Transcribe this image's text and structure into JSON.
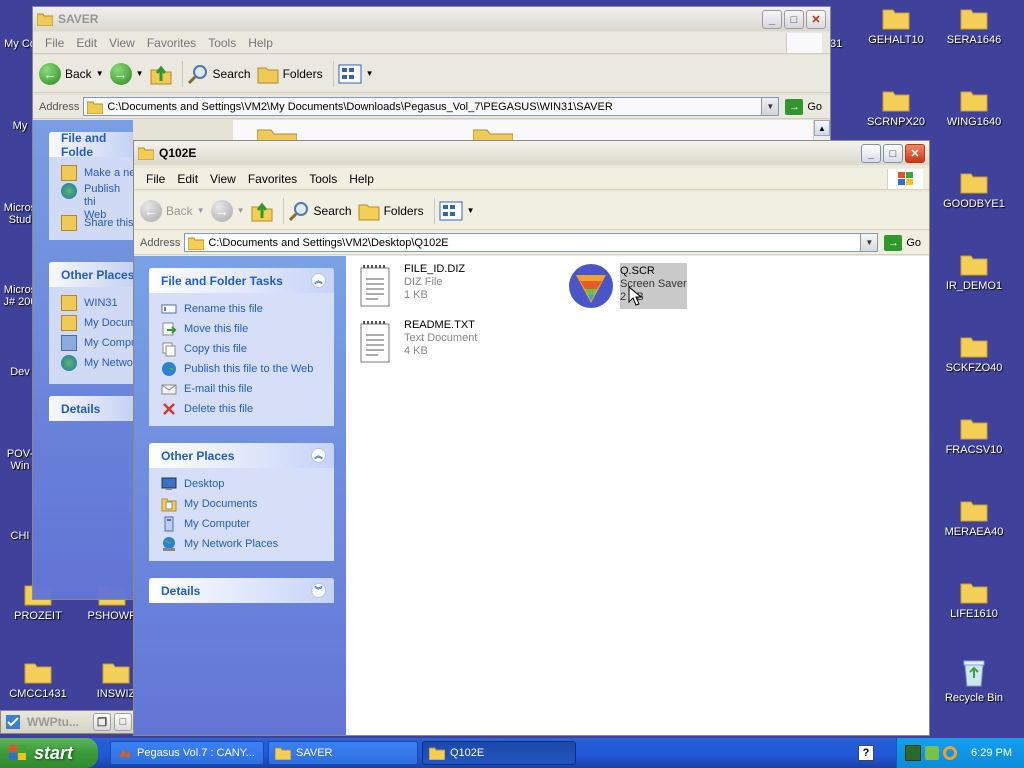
{
  "desktop": {
    "left_icons": [
      {
        "label": "My Co"
      },
      {
        "label": "My"
      },
      {
        "label": "Micros Stud"
      },
      {
        "label": "Micros J# 200"
      },
      {
        "label": "Dev"
      },
      {
        "label": "POV- Win"
      },
      {
        "label": "CHI"
      },
      {
        "label": "PROZEIT"
      },
      {
        "label": "PSHOWP"
      },
      {
        "label": "CMCC1431"
      },
      {
        "label": "INSWIZ"
      }
    ],
    "right_icons": [
      {
        "label": "GEHALT10"
      },
      {
        "label": "SERA1646"
      },
      {
        "label": "SCRNPX20"
      },
      {
        "label": "WING1640"
      },
      {
        "label": "GOODBYE1"
      },
      {
        "label": "IR_DEMO1"
      },
      {
        "label": "SCKFZO40"
      },
      {
        "label": "FRACSV10"
      },
      {
        "label": "MERAEA40"
      },
      {
        "label": "LIFE1610"
      },
      {
        "label": "Recycle Bin"
      }
    ],
    "partial_label": "31"
  },
  "back_window": {
    "title": "SAVER",
    "menu": [
      "File",
      "Edit",
      "View",
      "Favorites",
      "Tools",
      "Help"
    ],
    "toolbar": {
      "back": "Back",
      "search": "Search",
      "folders": "Folders"
    },
    "address_label": "Address",
    "address": "C:\\Documents and Settings\\VM2\\My Documents\\Downloads\\Pegasus_Vol_7\\PEGASUS\\WIN31\\SAVER",
    "go": "Go",
    "tasks_header": "File and Folde",
    "tasks": [
      "Make a ne",
      "Publish thi Web",
      "Share this"
    ],
    "places_header": "Other Places",
    "places": [
      "WIN31",
      "My Docum",
      "My Compu",
      "My Netwo"
    ],
    "details_header": "Details"
  },
  "front_window": {
    "title": "Q102E",
    "menu": [
      "File",
      "Edit",
      "View",
      "Favorites",
      "Tools",
      "Help"
    ],
    "toolbar": {
      "back": "Back",
      "search": "Search",
      "folders": "Folders"
    },
    "address_label": "Address",
    "address": "C:\\Documents and Settings\\VM2\\Desktop\\Q102E",
    "go": "Go",
    "tasks_header": "File and Folder Tasks",
    "tasks": [
      "Rename this file",
      "Move this file",
      "Copy this file",
      "Publish this file to the Web",
      "E-mail this file",
      "Delete this file"
    ],
    "places_header": "Other Places",
    "places": [
      "Desktop",
      "My Documents",
      "My Computer",
      "My Network Places"
    ],
    "details_header": "Details",
    "files": [
      {
        "name": "FILE_ID.DIZ",
        "type": "DIZ File",
        "size": "1 KB"
      },
      {
        "name": "Q.SCR",
        "type": "Screen Saver",
        "size": "2 KB"
      },
      {
        "name": "README.TXT",
        "type": "Text Document",
        "size": "4 KB"
      }
    ]
  },
  "mini_window": {
    "title": "WWPtu..."
  },
  "taskbar": {
    "start": "start",
    "tasks": [
      "Pegasus Vol.7 : CANY...",
      "SAVER",
      "Q102E"
    ],
    "clock": "6:29 PM"
  }
}
